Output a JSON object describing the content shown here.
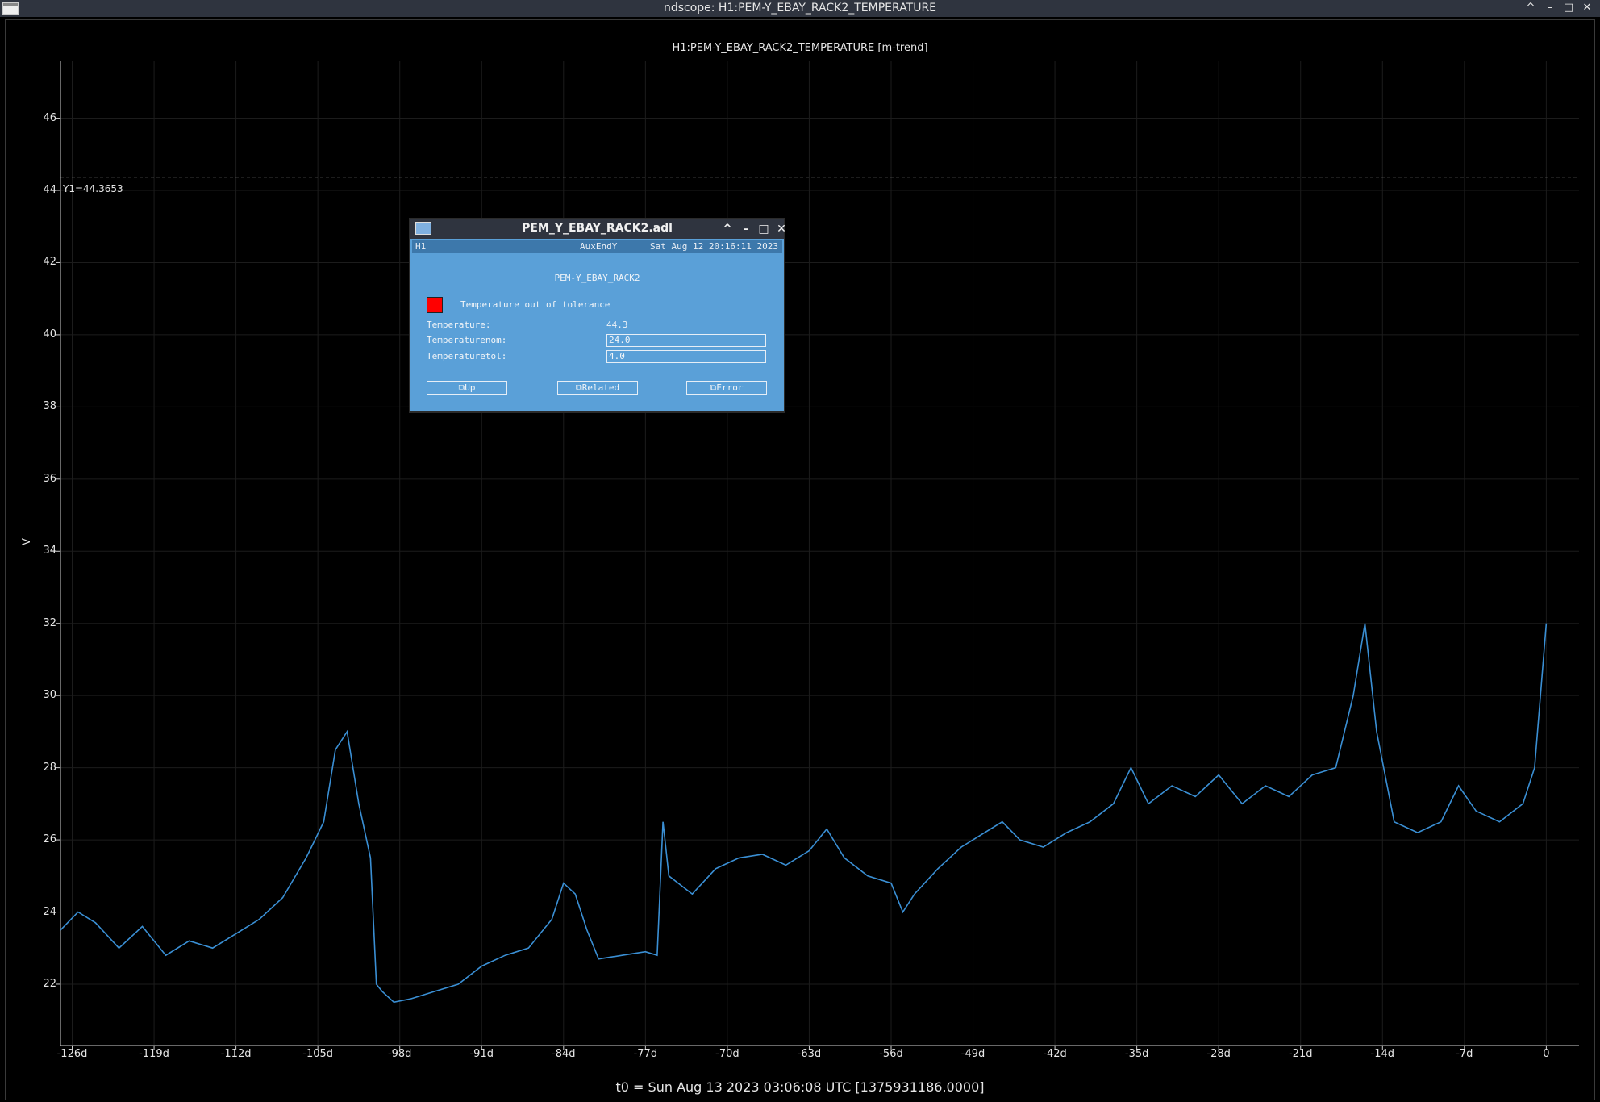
{
  "window": {
    "title": "ndscope: H1:PEM-Y_EBAY_RACK2_TEMPERATURE",
    "controls": [
      "^",
      "–",
      "□",
      "✕"
    ]
  },
  "plot": {
    "title": "H1:PEM-Y_EBAY_RACK2_TEMPERATURE [m-trend]",
    "ylabel": "V",
    "cursor_label": "Y1=44.3653",
    "t0_label": "t0 = Sun Aug 13 2023 03:06:08 UTC [1375931186.0000]"
  },
  "chart_data": {
    "type": "line",
    "title": "H1:PEM-Y_EBAY_RACK2_TEMPERATURE [m-trend]",
    "xlabel": "",
    "ylabel": "V",
    "xlim": [
      -127,
      2.8
    ],
    "ylim": [
      20.3,
      47.6
    ],
    "grid": true,
    "x_ticks": [
      -126,
      -119,
      -112,
      -105,
      -98,
      -91,
      -84,
      -77,
      -70,
      -63,
      -56,
      -49,
      -42,
      -35,
      -28,
      -21,
      -14,
      -7,
      0
    ],
    "x_tick_labels": [
      "-126d",
      "-119d",
      "-112d",
      "-105d",
      "-98d",
      "-91d",
      "-84d",
      "-77d",
      "-70d",
      "-63d",
      "-56d",
      "-49d",
      "-42d",
      "-35d",
      "-28d",
      "-21d",
      "-14d",
      "-7d",
      "0"
    ],
    "y_ticks": [
      22,
      24,
      26,
      28,
      30,
      32,
      34,
      36,
      38,
      40,
      42,
      44,
      46
    ],
    "cursor_y": 44.3653,
    "series": [
      {
        "color": "#3a8fd4",
        "x": [
          -127,
          -125.5,
          -124,
          -122,
          -120,
          -118,
          -116,
          -114,
          -112,
          -110,
          -108,
          -106,
          -104.5,
          -103.5,
          -102.5,
          -101.5,
          -100.5,
          -100,
          -99.5,
          -98.5,
          -97,
          -95,
          -93,
          -91,
          -89,
          -87,
          -85,
          -84,
          -83,
          -82,
          -81,
          -79,
          -77,
          -76,
          -75.5,
          -75,
          -73,
          -71,
          -69,
          -67,
          -65,
          -63,
          -61.5,
          -60,
          -58,
          -56,
          -55,
          -54,
          -52,
          -50,
          -48,
          -46.5,
          -45,
          -43,
          -41,
          -39,
          -37,
          -35.5,
          -34,
          -32,
          -30,
          -28,
          -26,
          -24,
          -22,
          -20,
          -18,
          -16.5,
          -15.5,
          -14.5,
          -13,
          -11,
          -9,
          -7.5,
          -6,
          -4,
          -2,
          -1,
          0
        ],
        "y": [
          23.5,
          24.0,
          23.7,
          23.0,
          23.6,
          22.8,
          23.2,
          23.0,
          23.4,
          23.8,
          24.4,
          25.5,
          26.5,
          28.5,
          29.0,
          27.0,
          25.5,
          22.0,
          21.8,
          21.5,
          21.6,
          21.8,
          22.0,
          22.5,
          22.8,
          23.0,
          23.8,
          24.8,
          24.5,
          23.5,
          22.7,
          22.8,
          22.9,
          22.8,
          26.5,
          25.0,
          24.5,
          25.2,
          25.5,
          25.6,
          25.3,
          25.7,
          26.3,
          25.5,
          25.0,
          24.8,
          24.0,
          24.5,
          25.2,
          25.8,
          26.2,
          26.5,
          26.0,
          25.8,
          26.2,
          26.5,
          27.0,
          28.0,
          27.0,
          27.5,
          27.2,
          27.8,
          27.0,
          27.5,
          27.2,
          27.8,
          28.0,
          30.0,
          32.0,
          29.0,
          26.5,
          26.2,
          26.5,
          27.5,
          26.8,
          26.5,
          27.0,
          28.0,
          32.0
        ]
      }
    ]
  },
  "dialog": {
    "title": "PEM_Y_EBAY_RACK2.adl",
    "controls": [
      "^",
      "–",
      "□",
      "✕"
    ],
    "status_site": "H1",
    "status_area": "AuxEndY",
    "status_time": "Sat Aug 12 20:16:11 2023",
    "heading": "PEM-Y_EBAY_RACK2",
    "alarm_text": "Temperature out of tolerance",
    "alarm_color": "#ff0000",
    "temperature_label": "Temperature:",
    "temperature_value": "44.3",
    "nom_label": "Temperaturenom:",
    "nom_value": "24.0",
    "tol_label": "Temperaturetol:",
    "tol_value": "4.0",
    "buttons": [
      "⧉Up",
      "⧉Related",
      "⧉Error"
    ]
  }
}
